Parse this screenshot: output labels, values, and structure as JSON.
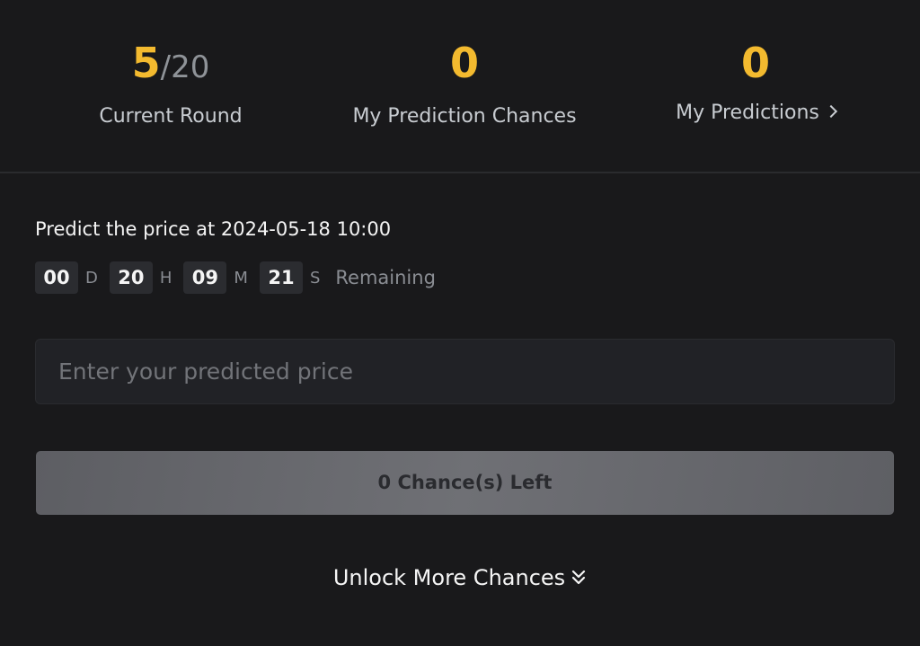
{
  "stats": {
    "current_round": {
      "value": "5",
      "total": "/20",
      "label": "Current Round"
    },
    "chances": {
      "value": "0",
      "label": "My Prediction Chances"
    },
    "predictions": {
      "value": "0",
      "label": "My Predictions",
      "icon": "chevron-right-icon"
    }
  },
  "prediction": {
    "title": "Predict the price at 2024-05-18 10:00",
    "countdown": {
      "days": "00",
      "days_unit": "D",
      "hours": "20",
      "hours_unit": "H",
      "minutes": "09",
      "minutes_unit": "M",
      "seconds": "21",
      "seconds_unit": "S",
      "suffix": "Remaining"
    },
    "price_input": {
      "placeholder": "Enter your predicted price",
      "value": ""
    },
    "submit_label": "0 Chance(s) Left",
    "unlock_label": "Unlock More Chances",
    "unlock_icon": "double-chevron-down-icon"
  },
  "colors": {
    "background": "#19191b",
    "accent": "#f3ba2f",
    "muted": "#8a8d93",
    "input_bg": "#212226",
    "button_bg": "#6b6c71"
  }
}
